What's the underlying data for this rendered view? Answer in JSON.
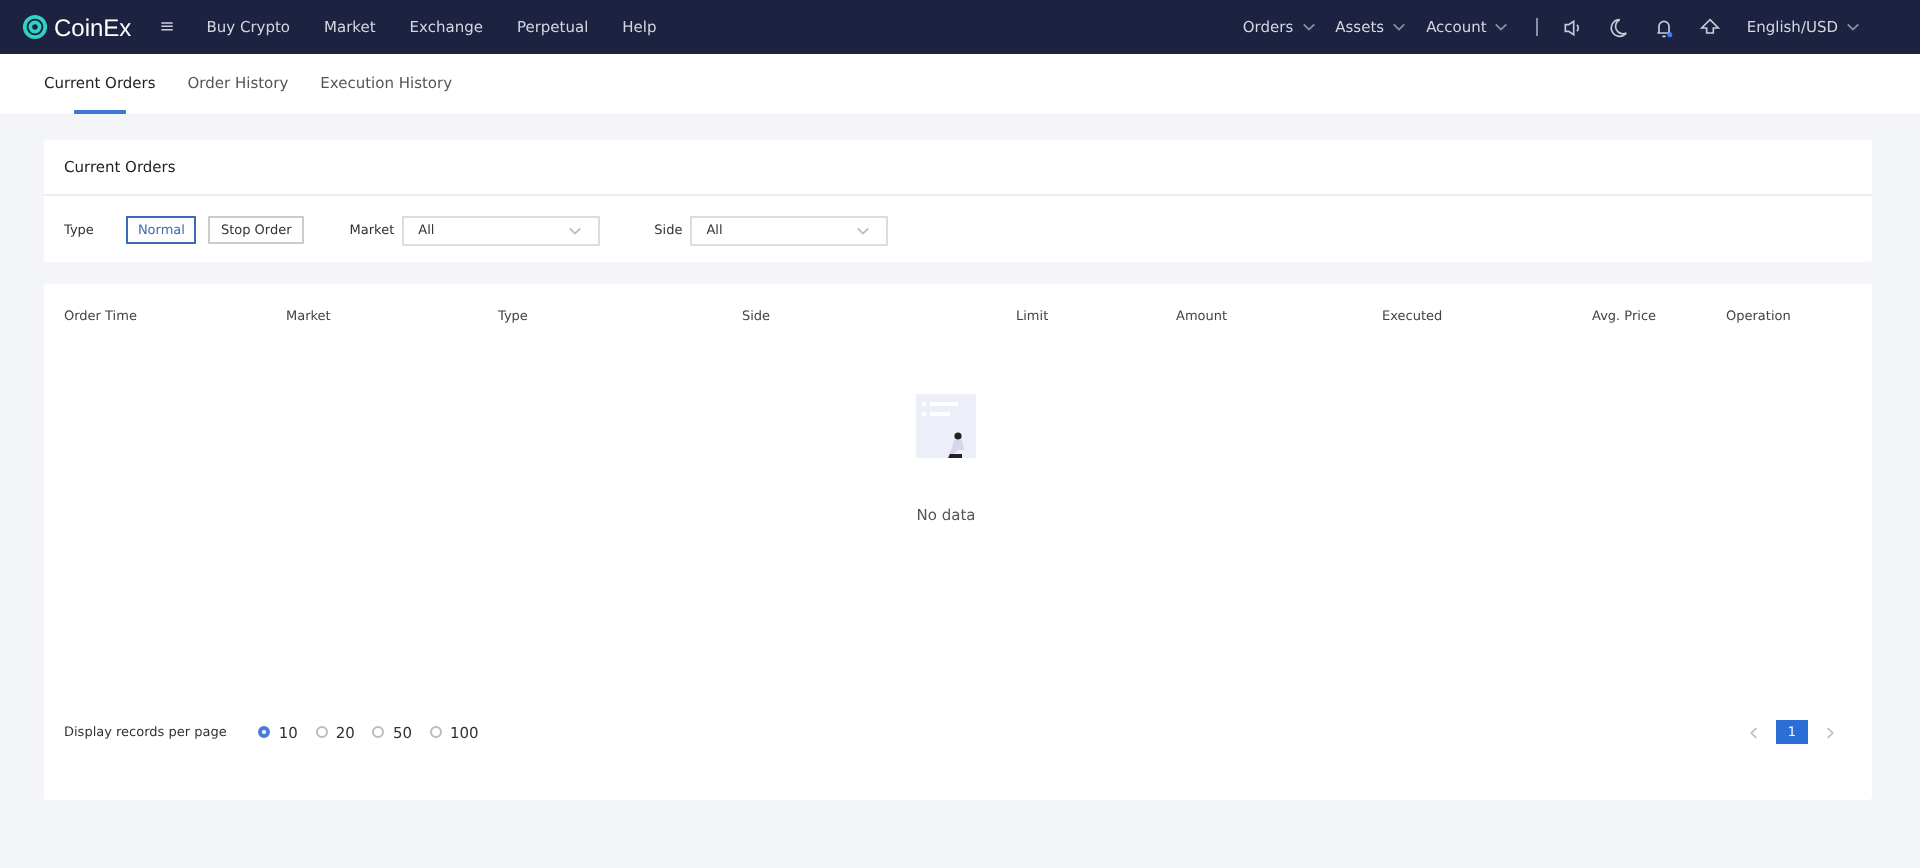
{
  "nav": {
    "logo": "CoinEx",
    "menu_icon": "≡",
    "left": [
      {
        "label": "Buy Crypto"
      },
      {
        "label": "Market"
      },
      {
        "label": "Exchange"
      },
      {
        "label": "Perpetual"
      },
      {
        "label": "Help"
      }
    ],
    "right": [
      {
        "label": "Orders",
        "dropdown": true
      },
      {
        "label": "Assets",
        "dropdown": true
      },
      {
        "label": "Account",
        "dropdown": true
      }
    ],
    "language": "English/USD"
  },
  "tabs": [
    {
      "label": "Current Orders",
      "selected": true
    },
    {
      "label": "Order History",
      "selected": false
    },
    {
      "label": "Execution History",
      "selected": false
    }
  ],
  "filter_card": {
    "title": "Current Orders",
    "type_label": "Type",
    "type_options": [
      {
        "label": "Normal",
        "selected": true
      },
      {
        "label": "Stop Order",
        "selected": false
      }
    ],
    "market_label": "Market",
    "market_value": "All",
    "side_label": "Side",
    "side_value": "All"
  },
  "table": {
    "columns": [
      "Order Time",
      "Market",
      "Type",
      "Side",
      "Limit",
      "Amount",
      "Executed",
      "Avg. Price",
      "Operation"
    ],
    "empty_text": "No data"
  },
  "footer": {
    "per_page_label": "Display records per page",
    "per_page_options": [
      {
        "label": "10",
        "selected": true
      },
      {
        "label": "20",
        "selected": false
      },
      {
        "label": "50",
        "selected": false
      },
      {
        "label": "100",
        "selected": false
      }
    ],
    "pages": [
      {
        "label": "1",
        "selected": true
      }
    ]
  }
}
